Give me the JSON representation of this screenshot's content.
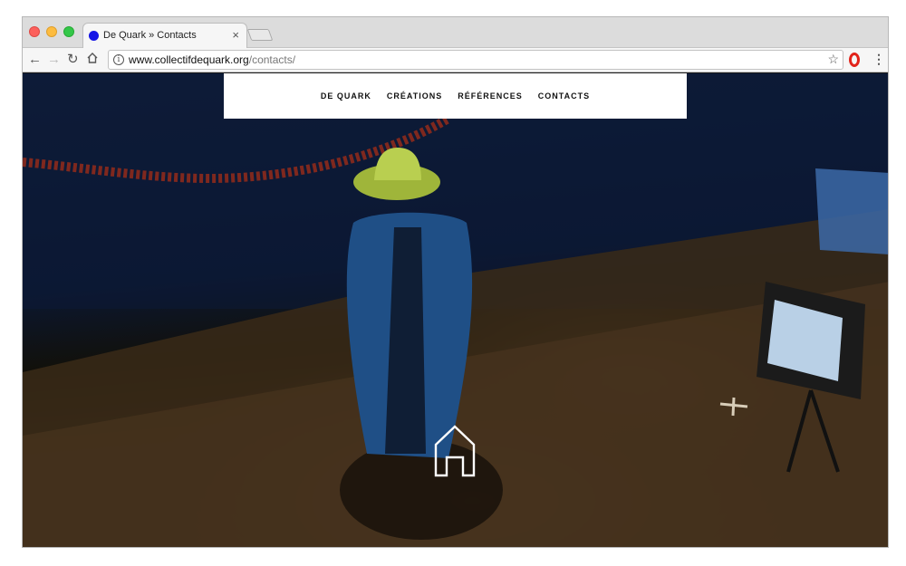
{
  "browser": {
    "tab": {
      "title": "De Quark » Contacts",
      "favicon_color": "#1414e6",
      "close_label": "×"
    },
    "address_bar": {
      "url_host": "www.collectifdequark.org",
      "url_path": "/contacts/"
    },
    "toolbar_icons": [
      "back-arrow-icon",
      "forward-arrow-icon",
      "reload-icon",
      "home-icon",
      "info-icon",
      "star-icon",
      "opera-icon",
      "menu-icon"
    ]
  },
  "site": {
    "nav": {
      "items": [
        {
          "label": "DE QUARK"
        },
        {
          "label": "CRÉATIONS"
        },
        {
          "label": "RÉFÉRENCES"
        },
        {
          "label": "CONTACTS"
        }
      ]
    },
    "hero_icon": "home-icon",
    "accent_colors": {
      "nav_background": "#ffffff",
      "nav_text": "#111111",
      "backdrop": "#0b1730"
    }
  }
}
